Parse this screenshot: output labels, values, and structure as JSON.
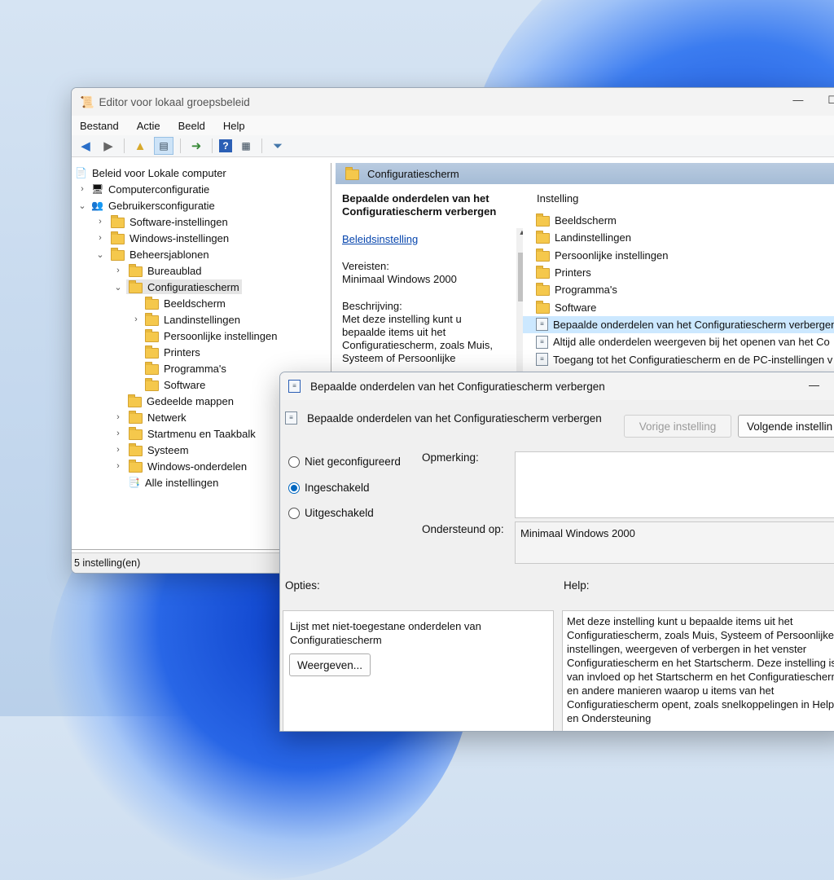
{
  "main_window": {
    "title": "Editor voor lokaal groepsbeleid",
    "minimize": "—",
    "maximize": "☐",
    "menu": [
      "Bestand",
      "Actie",
      "Beeld",
      "Help"
    ],
    "tree": {
      "root": "Beleid voor Lokale computer",
      "computer": "Computerconfiguratie",
      "user": "Gebruikersconfiguratie",
      "software": "Software-instellingen",
      "windows": "Windows-instellingen",
      "admin": "Beheersjablonen",
      "desktop": "Bureaublad",
      "control_panel": "Configuratiescherm",
      "display": "Beeldscherm",
      "regional": "Landinstellingen",
      "personal": "Persoonlijke instellingen",
      "printers": "Printers",
      "programs": "Programma's",
      "software2": "Software",
      "shared": "Gedeelde mappen",
      "network": "Netwerk",
      "startmenu": "Startmenu en Taakbalk",
      "system": "Systeem",
      "wincomp": "Windows-onderdelen",
      "all": "Alle instellingen"
    },
    "status": "5 instelling(en)",
    "right_header": "Configuratiescherm",
    "desc": {
      "title": "Bepaalde onderdelen van het Configuratiescherm verbergen",
      "link": "Beleidsinstelling",
      "req_label": "Vereisten:",
      "req_value": "Minimaal Windows 2000",
      "desc_label": "Beschrijving:",
      "desc_text": "Met deze instelling kunt u bepaalde items uit het Configuratiescherm, zoals Muis, Systeem of Persoonlijke"
    },
    "list_header": "Instelling",
    "list_folders": [
      "Beeldscherm",
      "Landinstellingen",
      "Persoonlijke instellingen",
      "Printers",
      "Programma's",
      "Software"
    ],
    "list_policies": [
      "Bepaalde onderdelen van het Configuratiescherm verbergen",
      "Altijd alle onderdelen weergeven bij het openen van het Co",
      "Toegang tot het Configuratiescherm en de PC-instellingen v"
    ]
  },
  "dialog": {
    "title": "Bepaalde onderdelen van het Configuratiescherm verbergen",
    "minimize": "—",
    "heading": "Bepaalde onderdelen van het Configuratiescherm verbergen",
    "prev": "Vorige instelling",
    "next": "Volgende instellin",
    "radios": [
      "Niet geconfigureerd",
      "Ingeschakeld",
      "Uitgeschakeld"
    ],
    "comment_label": "Opmerking:",
    "supported_label": "Ondersteund op:",
    "supported_value": "Minimaal Windows 2000",
    "options_label": "Opties:",
    "help_label": "Help:",
    "options_text": "Lijst met niet-toegestane onderdelen van Configuratiescherm",
    "show_button": "Weergeven...",
    "help_text": "Met deze instelling kunt u bepaalde items uit het Configuratiescherm, zoals Muis, Systeem of Persoonlijke instellingen, weergeven of verbergen in het venster Configuratiescherm en het Startscherm. Deze instelling is van invloed op het Startscherm en het Configuratiescherm en andere manieren waarop u items van het Configuratiescherm opent, zoals snelkoppelingen in Help en Ondersteuning"
  }
}
